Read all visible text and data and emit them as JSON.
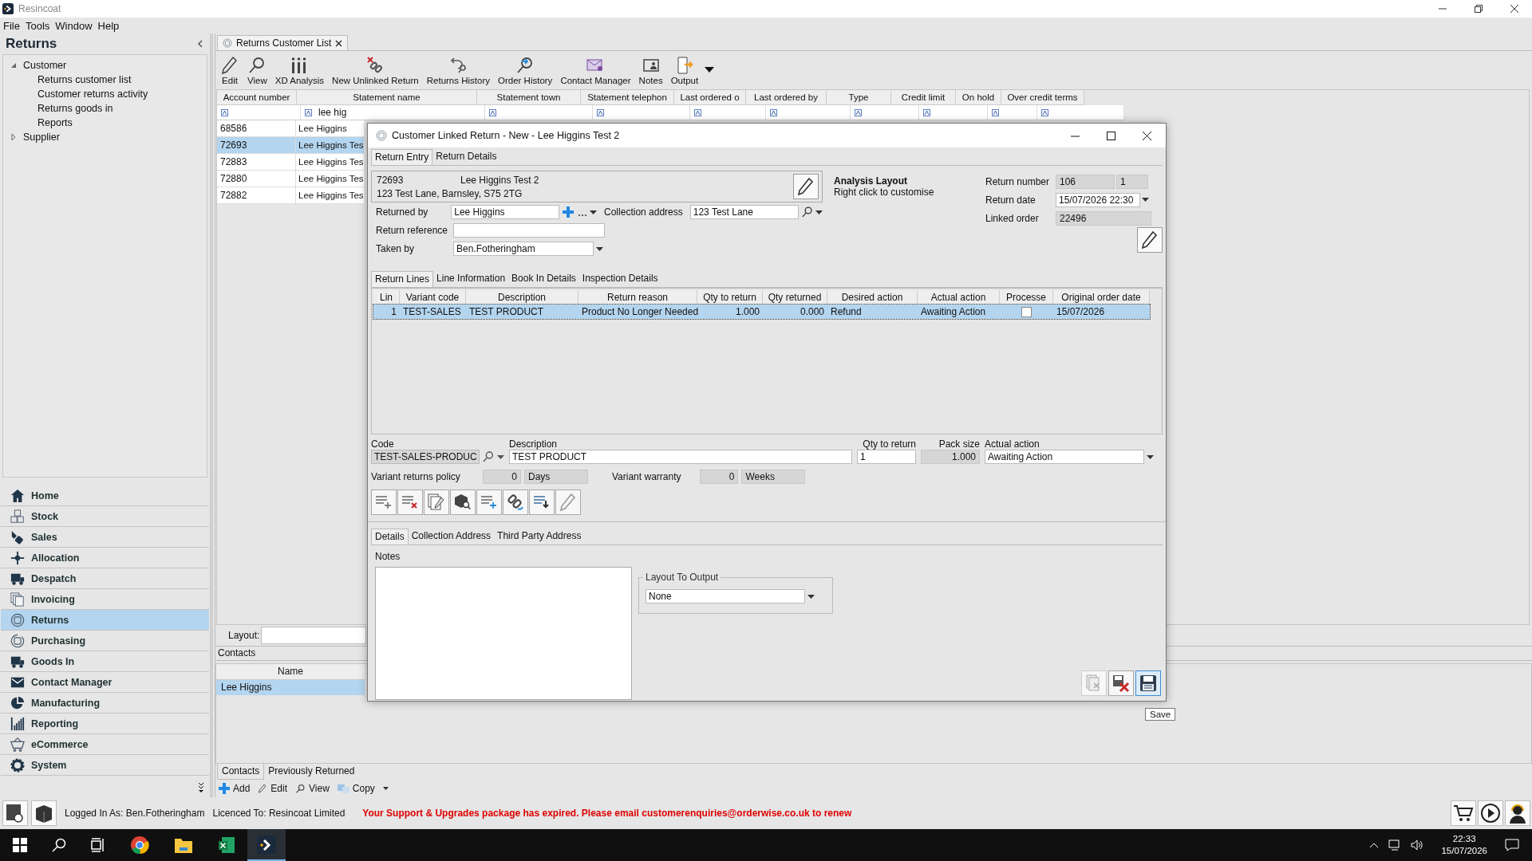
{
  "window": {
    "title": "Resincoat",
    "menu": [
      "File",
      "Tools",
      "Window",
      "Help"
    ]
  },
  "sidebar": {
    "title": "Returns",
    "tree": [
      {
        "label": "Customer",
        "expanded": true,
        "children": [
          {
            "label": "Returns customer list"
          },
          {
            "label": "Customer returns activity"
          },
          {
            "label": "Returns goods in"
          },
          {
            "label": "Reports"
          }
        ]
      },
      {
        "label": "Supplier",
        "expanded": false
      }
    ],
    "nav": [
      {
        "label": "Home",
        "kind": "home",
        "selected": false
      },
      {
        "label": "Stock",
        "kind": "boxes",
        "selected": false
      },
      {
        "label": "Sales",
        "kind": "tag",
        "selected": false
      },
      {
        "label": "Allocation",
        "kind": "cross",
        "selected": false
      },
      {
        "label": "Despatch",
        "kind": "truck",
        "selected": false
      },
      {
        "label": "Invoicing",
        "kind": "pages",
        "selected": false
      },
      {
        "label": "Returns",
        "kind": "target",
        "selected": true
      },
      {
        "label": "Purchasing",
        "kind": "cycle",
        "selected": false
      },
      {
        "label": "Goods In",
        "kind": "truck",
        "selected": false
      },
      {
        "label": "Contact Manager",
        "kind": "envelope",
        "selected": false
      },
      {
        "label": "Manufacturing",
        "kind": "pie",
        "selected": false
      },
      {
        "label": "Reporting",
        "kind": "bars",
        "selected": false
      },
      {
        "label": "eCommerce",
        "kind": "basket",
        "selected": false
      },
      {
        "label": "System",
        "kind": "gear",
        "selected": false
      }
    ]
  },
  "document_tab": {
    "label": "Returns Customer List",
    "selected": true
  },
  "toolbar": [
    {
      "label": "Edit",
      "kind": "pencil"
    },
    {
      "label": "View",
      "kind": "search"
    },
    {
      "label": "XD Analysis",
      "kind": "bars"
    },
    {
      "label": "New Unlinked Return",
      "kind": "unlink"
    },
    {
      "label": "Returns History",
      "kind": "return"
    },
    {
      "label": "Order History",
      "kind": "search-arrow"
    },
    {
      "label": "Contact Manager",
      "kind": "envelope"
    },
    {
      "label": "Notes",
      "kind": "card"
    },
    {
      "label": "Output",
      "kind": "output"
    }
  ],
  "customer_table": {
    "columns": [
      "Account number",
      "Statement name",
      "Statement town",
      "Statement telephon",
      "Last ordered o",
      "Last ordered by",
      "Type",
      "Credit limit",
      "On hold",
      "Over credit terms"
    ],
    "name_filter": "lee hig",
    "rows": [
      {
        "account_number": "68586",
        "statement_name": "Lee Higgins",
        "selected": false
      },
      {
        "account_number": "72693",
        "statement_name": "Lee Higgins Tes",
        "selected": true
      },
      {
        "account_number": "72883",
        "statement_name": "Lee Higgins Tes",
        "selected": false
      },
      {
        "account_number": "72880",
        "statement_name": "Lee Higgins Tes",
        "selected": false
      },
      {
        "account_number": "72882",
        "statement_name": "Lee Higgins Tes",
        "selected": false
      }
    ]
  },
  "layout": {
    "label": "Layout:"
  },
  "contacts": {
    "title": "Contacts",
    "column": "Name",
    "rows": [
      {
        "name": "Lee Higgins",
        "selected": true
      }
    ],
    "tabs": [
      {
        "label": "Contacts",
        "selected": true
      },
      {
        "label": "Previously Returned",
        "selected": false
      }
    ],
    "actions": [
      {
        "label": "Add",
        "kind": "plus"
      },
      {
        "label": "Edit",
        "kind": "pencil"
      },
      {
        "label": "View",
        "kind": "search"
      },
      {
        "label": "Copy",
        "kind": "copy"
      }
    ]
  },
  "status_bar": {
    "logged_in": "Logged In As: Ben.Fotheringham",
    "licence": "Licenced To: Resincoat Limited",
    "warning": "Your Support & Upgrades package has expired. Please email customerenquiries@orderwise.co.uk to renew"
  },
  "taskbar": {
    "time": "22:33",
    "date": "15/07/2026"
  },
  "dialog": {
    "title": "Customer Linked Return - New - Lee Higgins Test 2",
    "tabs": [
      {
        "label": "Return Entry",
        "selected": true
      },
      {
        "label": "Return Details",
        "selected": false
      }
    ],
    "customer": {
      "account": "72693",
      "name": "Lee Higgins Test 2",
      "address": "123 Test Lane, Barnsley, S75 2TG"
    },
    "analysis": {
      "title": "Analysis Layout",
      "hint": "Right click to customise"
    },
    "returned_by": {
      "label": "Returned by",
      "value": "Lee Higgins"
    },
    "collection_address": {
      "label": "Collection address",
      "value": "123 Test Lane"
    },
    "return_reference": {
      "label": "Return reference"
    },
    "taken_by": {
      "label": "Taken by",
      "value": "Ben.Fotheringham"
    },
    "return_number": {
      "label": "Return number",
      "value": "106",
      "suffix": "1"
    },
    "return_date": {
      "label": "Return date",
      "value": "15/07/2026 22:30"
    },
    "linked_order": {
      "label": "Linked order",
      "value": "22496"
    },
    "line_tabs": [
      {
        "label": "Return Lines",
        "selected": true
      },
      {
        "label": "Line Information",
        "selected": false
      },
      {
        "label": "Book In Details",
        "selected": false
      },
      {
        "label": "Inspection Details",
        "selected": false
      }
    ],
    "lines": {
      "columns": [
        "Lin",
        "Variant code",
        "Description",
        "Return reason",
        "Qty to return",
        "Qty returned",
        "Desired action",
        "Actual action",
        "Processe",
        "Original order date"
      ],
      "rows": [
        {
          "cells": [
            "1",
            "TEST-SALES",
            "TEST PRODUCT",
            "Product No Longer Needed",
            "1.000",
            "0.000",
            "Refund",
            "Awaiting Action"
          ],
          "processed": false,
          "date": "15/07/2026",
          "selected": true
        }
      ]
    },
    "editor": {
      "code_label": "Code",
      "code": "TEST-SALES-PRODUC",
      "description_label": "Description",
      "description": "TEST PRODUCT",
      "qty_label": "Qty to return",
      "qty": "1",
      "pack_label": "Pack size",
      "pack": "1.000",
      "action_label": "Actual action",
      "action": "Awaiting Action",
      "policy_label": "Variant returns policy",
      "policy": "0",
      "policy_unit": "Days",
      "warranty_label": "Variant warranty",
      "warranty": "0",
      "warranty_unit": "Weeks"
    },
    "detail_tabs": [
      {
        "label": "Details",
        "selected": true
      },
      {
        "label": "Collection Address",
        "selected": false
      },
      {
        "label": "Third Party Address",
        "selected": false
      }
    ],
    "notes_label": "Notes",
    "output": {
      "title": "Layout To Output",
      "value": "None"
    },
    "tooltip": "Save"
  }
}
